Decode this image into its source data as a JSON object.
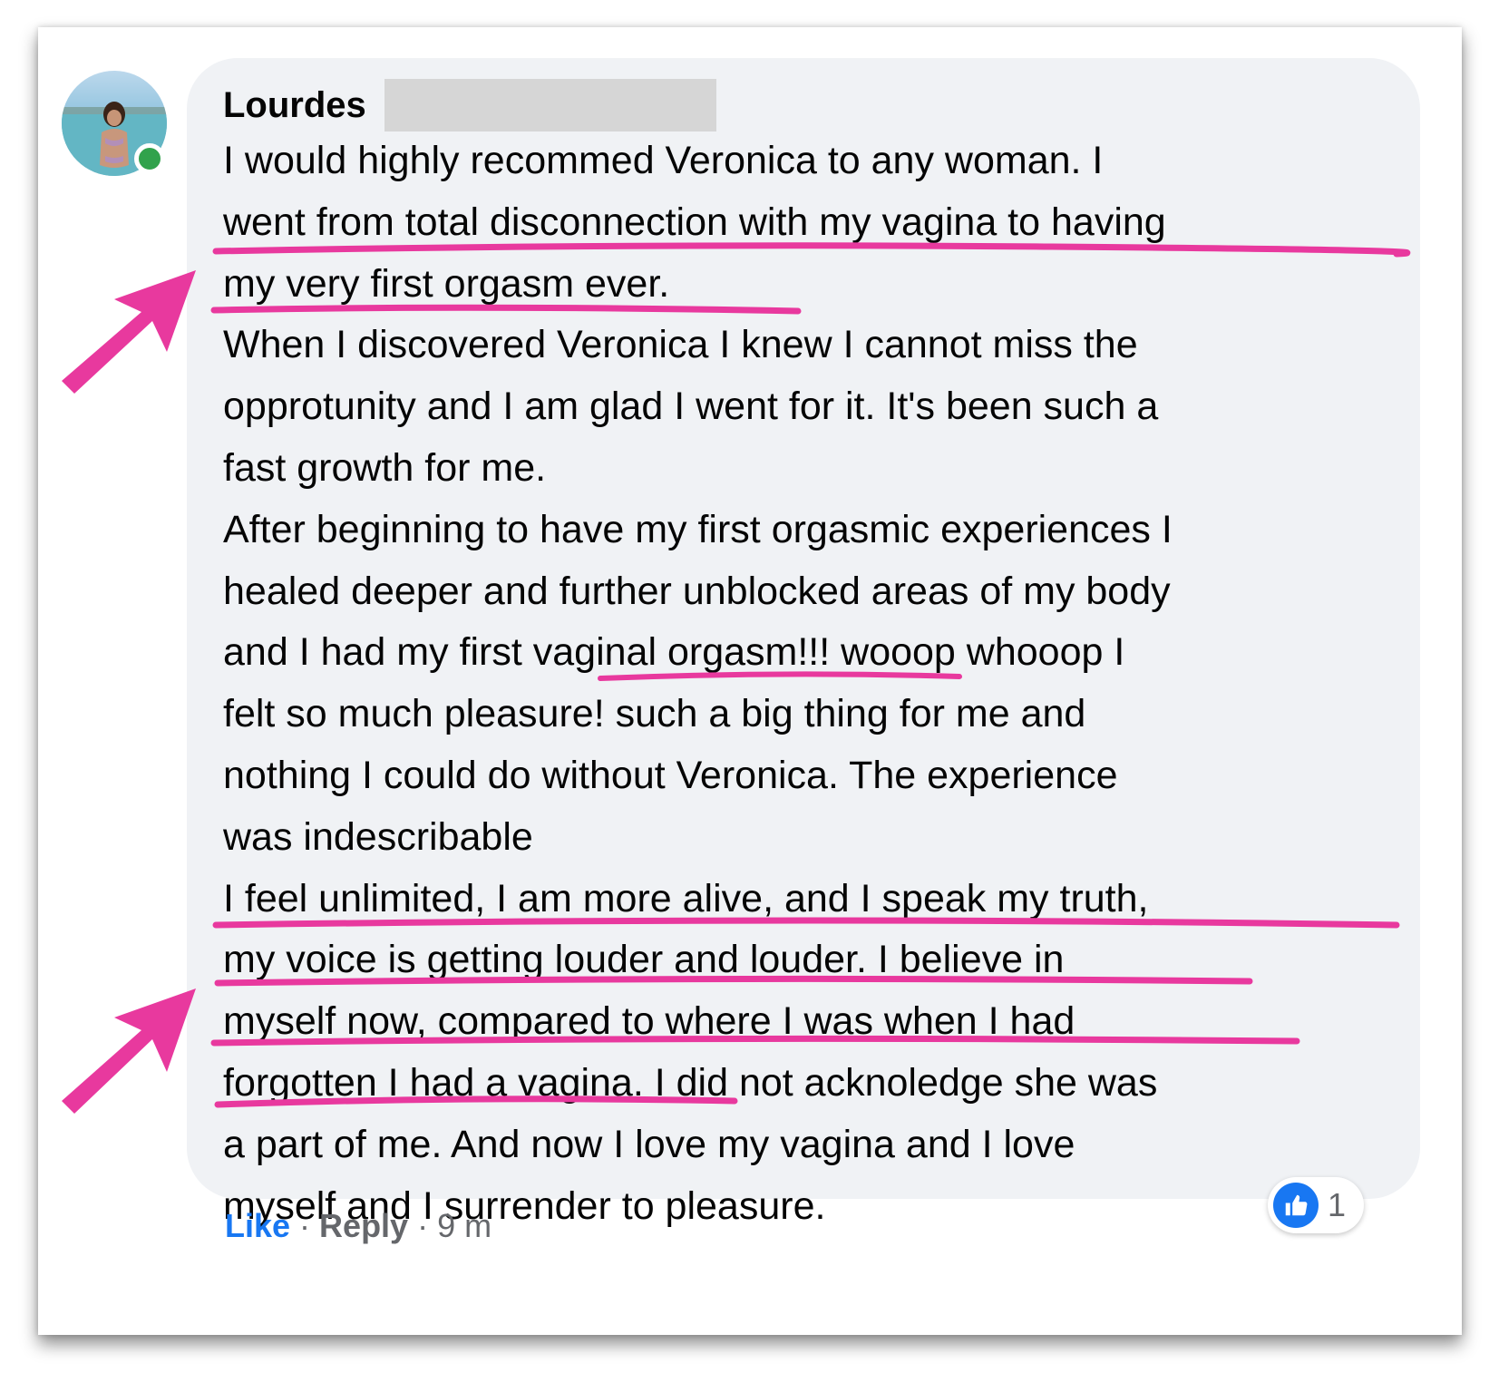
{
  "comment": {
    "author": "Lourdes",
    "text_lines": [
      "I would highly recommed Veronica to any woman. I",
      "went from total disconnection with my vagina to having",
      "my very first orgasm ever.",
      "When I discovered Veronica I knew I cannot miss the",
      "opprotunity and I am glad I went for it. It's been such a",
      "fast growth for me.",
      "After beginning to have my first orgasmic experiences I",
      "healed deeper and further unblocked areas of my body",
      "and I had my first vaginal orgasm!!! wooop whooop I",
      "felt so much pleasure! such a big thing for me and",
      "nothing I could do without Veronica. The experience",
      "was indescribable",
      "I feel unlimited, I am more alive, and I speak my truth,",
      "my voice is getting louder and louder. I believe in",
      "myself now, compared to where I was when I had",
      "forgotten I had a vagina. I did not acknoledge she was",
      "a part of me. And now I love my vagina and I love",
      "myself and I surrender to pleasure."
    ]
  },
  "actions": {
    "like_label": "Like",
    "reply_label": "Reply",
    "separator": "·",
    "time": "9 m"
  },
  "reactions": {
    "icon": "thumbs-up-icon",
    "count": "1"
  },
  "colors": {
    "highlight_pink": "#e8399e",
    "facebook_blue": "#1877f2",
    "bubble_gray": "#f0f2f5",
    "online_green": "#31a24c",
    "redaction_gray": "#d6d6d6"
  },
  "annotations": {
    "underlines": [
      "went from total disconnection with my vagina to having",
      "my very first orgasm ever",
      "vaginal orgasm!!!",
      "I feel unlimited, I am more alive, and I speak my truth,",
      "my voice is getting louder and louder. I believe in",
      "myself now, compared to where I was when I had",
      "forgotten I had a vagina."
    ],
    "arrow_count": 2
  }
}
